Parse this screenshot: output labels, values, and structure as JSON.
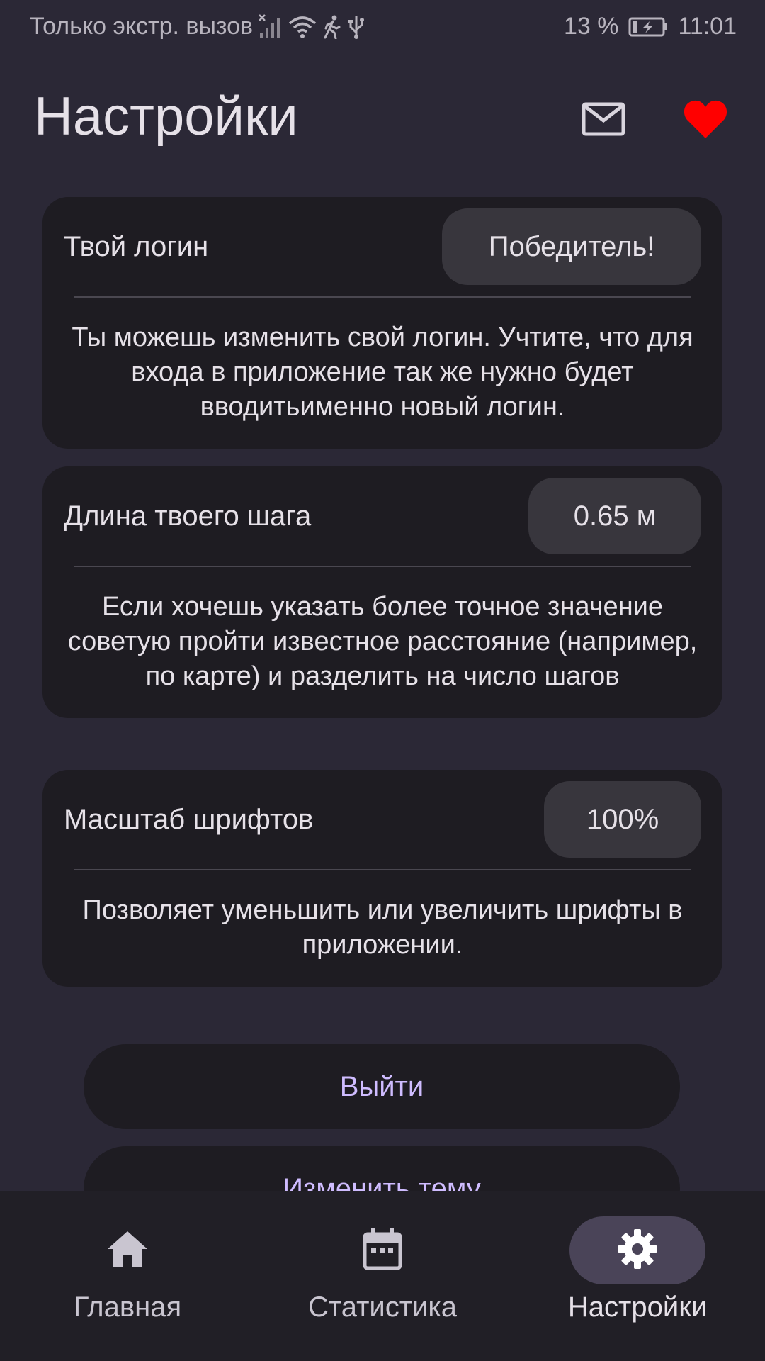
{
  "status_bar": {
    "carrier_text": "Только экстр. вызов",
    "battery_percent": "13 %",
    "time": "11:01",
    "icons": [
      "signal-icon",
      "wifi-icon",
      "walking-icon",
      "usb-icon",
      "battery-charging-icon"
    ]
  },
  "header": {
    "title": "Настройки",
    "actions": [
      "mail-icon",
      "heart-icon"
    ],
    "heart_color": "#ff0000"
  },
  "settings": {
    "login": {
      "label": "Твой логин",
      "value": "Победитель!",
      "description": "Ты можешь изменить свой логин. Учтите, что для входа в приложение так же нужно будет вводитьименно новый логин."
    },
    "step_length": {
      "label": "Длина твоего шага",
      "value": "0.65 м",
      "description": "Если хочешь указать более точное значение советую пройти известное расстояние (например, по карте) и разделить на число шагов"
    },
    "font_scale": {
      "label": "Масштаб шрифтов",
      "value": "100%",
      "description": "Позволяет уменьшить или увеличить шрифты в приложении."
    }
  },
  "buttons": {
    "logout": "Выйти",
    "change_theme": "Изменить тему"
  },
  "bottom_nav": {
    "items": [
      {
        "label": "Главная",
        "icon": "home-icon",
        "active": false
      },
      {
        "label": "Статистика",
        "icon": "calendar-icon",
        "active": false
      },
      {
        "label": "Настройки",
        "icon": "gear-icon",
        "active": true
      }
    ]
  },
  "colors": {
    "background": "#2b2836",
    "card": "#1e1c22",
    "value_chip": "#38363d",
    "accent_text": "#cfbcff",
    "nav_active_pill": "#4a4458"
  }
}
